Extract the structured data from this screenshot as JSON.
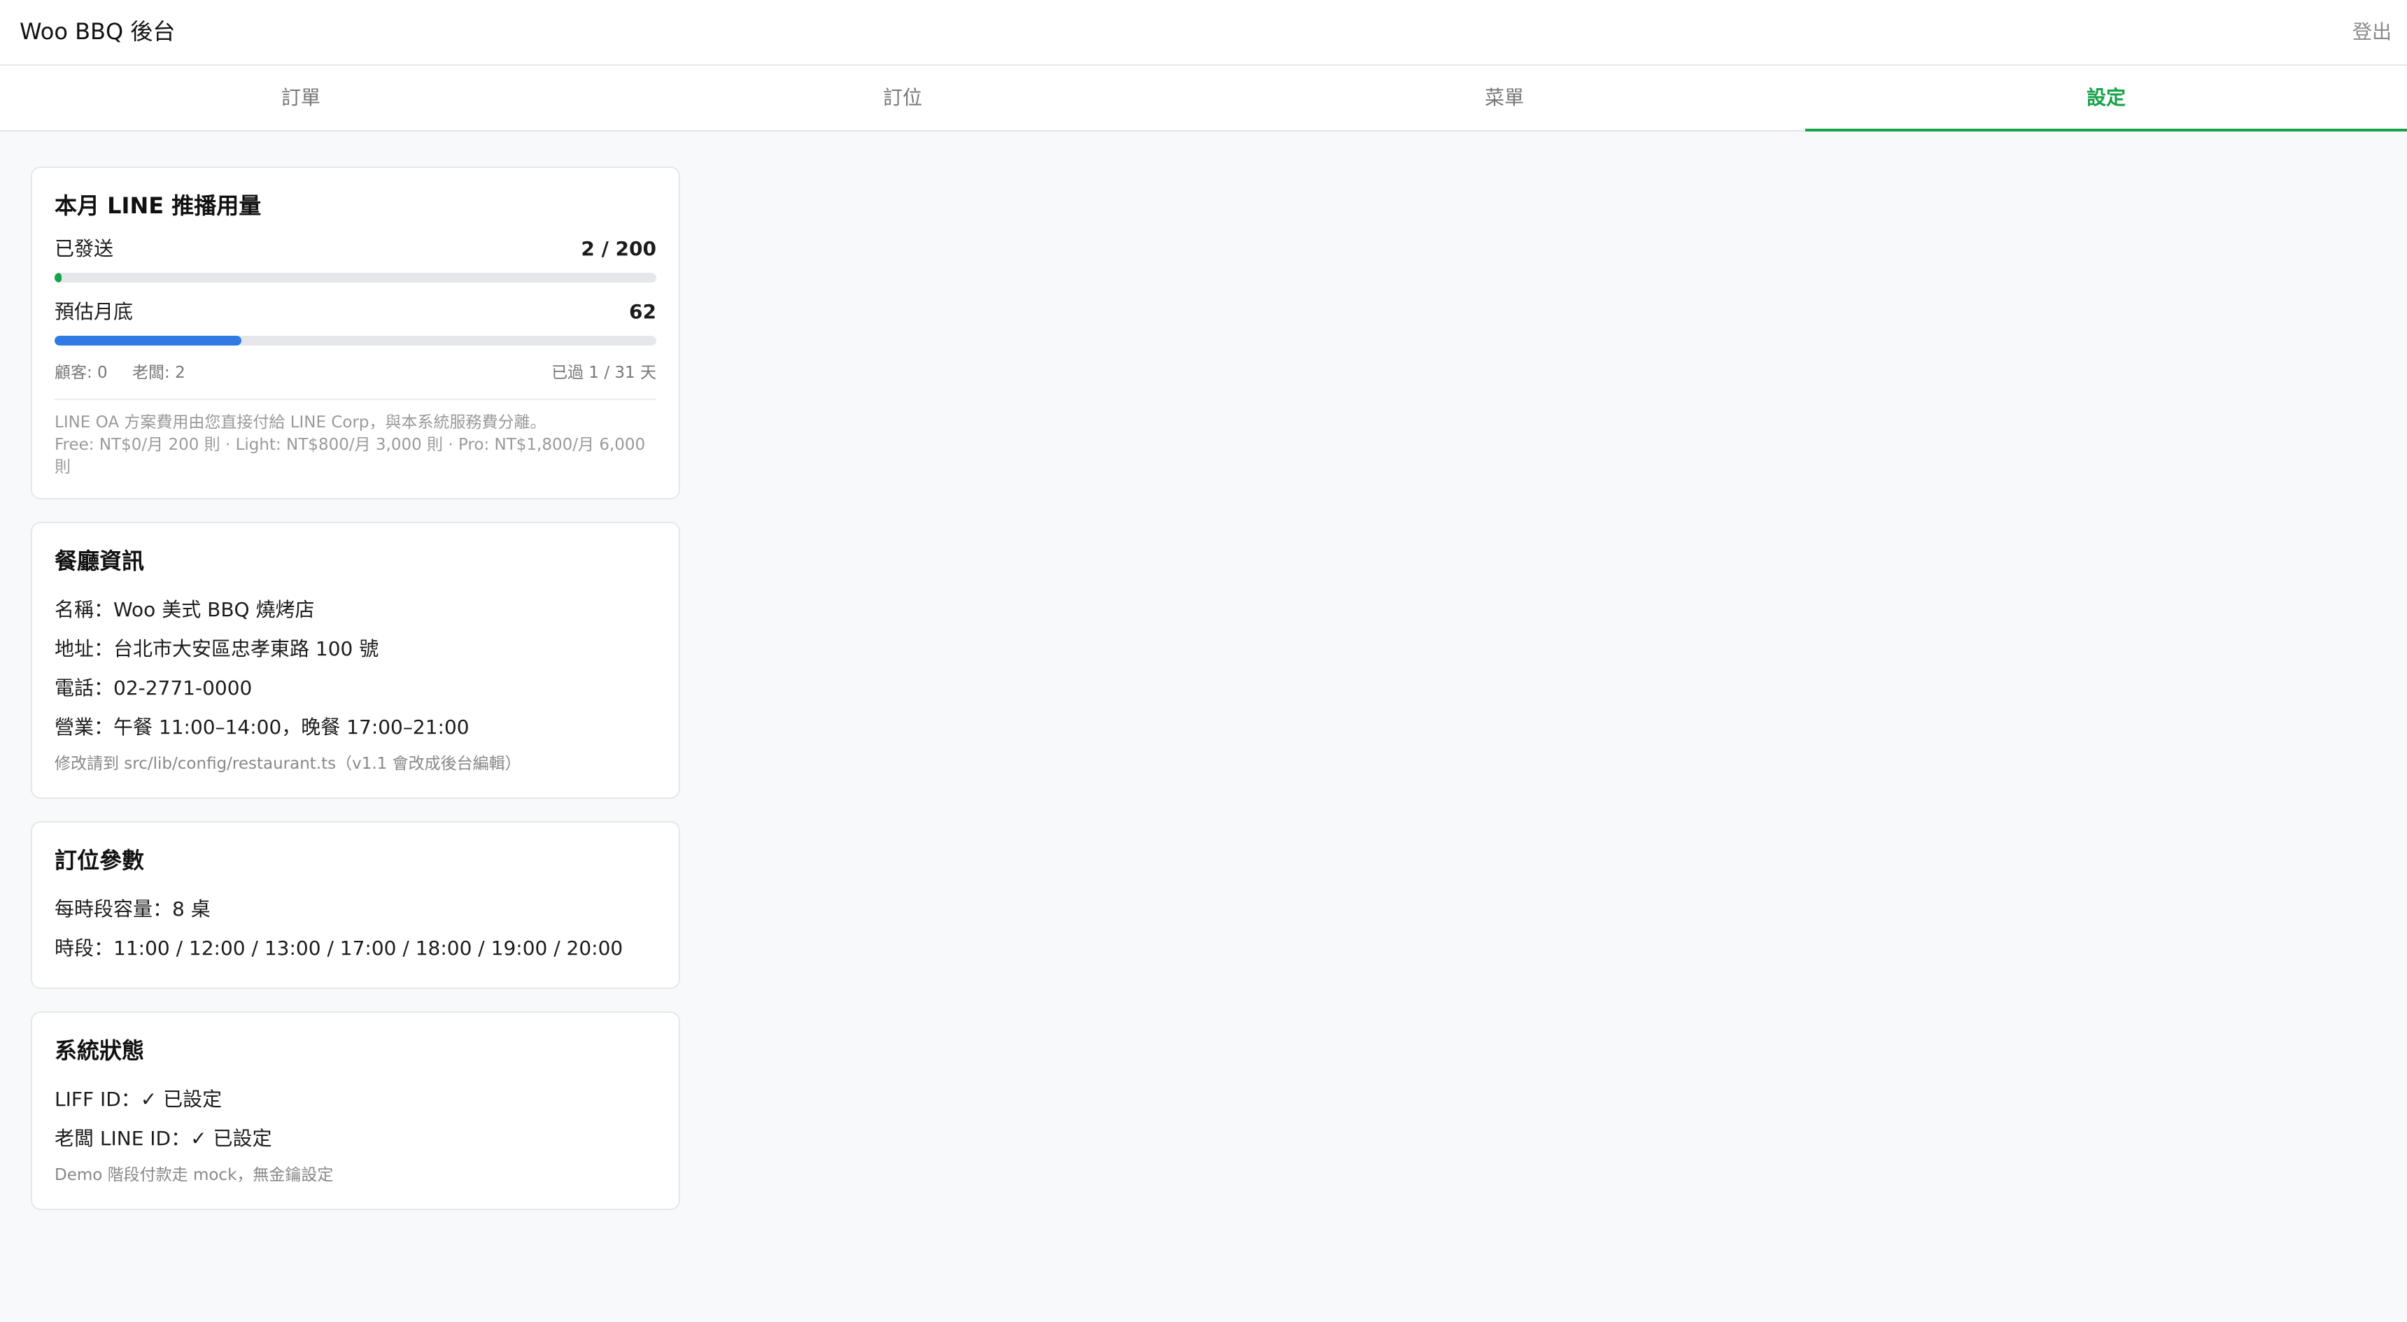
{
  "app": {
    "title": "Woo BBQ 後台",
    "logout_label": "登出"
  },
  "tabs": [
    {
      "label": "訂單",
      "active": false
    },
    {
      "label": "訂位",
      "active": false
    },
    {
      "label": "菜單",
      "active": false
    },
    {
      "label": "設定",
      "active": true
    }
  ],
  "usage": {
    "title": "本月 LINE 推播用量",
    "sent_label": "已發送",
    "sent_value": "2 / 200",
    "sent_fraction": 0.01,
    "forecast_label": "預估月底",
    "forecast_value": "62",
    "forecast_fraction": 0.31,
    "customers_text": "顧客: 0",
    "owner_text": "老闆: 2",
    "days_text": "已過 1 / 31 天",
    "note_line1": "LINE OA 方案費用由您直接付給 LINE Corp，與本系統服務費分離。",
    "note_line2": "Free: NT$0/月 200 則 · Light: NT$800/月 3,000 則 · Pro: NT$1,800/月 6,000 則",
    "sent_color": "#16a34a",
    "forecast_color": "#2f7ae5"
  },
  "restaurant": {
    "title": "餐廳資訊",
    "name_line": "名稱：Woo 美式 BBQ 燒烤店",
    "address_line": "地址：台北市大安區忠孝東路 100 號",
    "phone_line": "電話：02-2771-0000",
    "hours_line": "營業：午餐 11:00–14:00，晚餐 17:00–21:00",
    "note": "修改請到 src/lib/config/restaurant.ts（v1.1 會改成後台編輯）"
  },
  "reservation": {
    "title": "訂位參數",
    "capacity_line": "每時段容量：8 桌",
    "slots_line": "時段：11:00 / 12:00 / 13:00 / 17:00 / 18:00 / 19:00 / 20:00"
  },
  "system": {
    "title": "系統狀態",
    "liff_line": "LIFF ID：✓ 已設定",
    "owner_line": "老闆 LINE ID：✓ 已設定",
    "note": "Demo 階段付款走 mock，無金鑰設定"
  }
}
